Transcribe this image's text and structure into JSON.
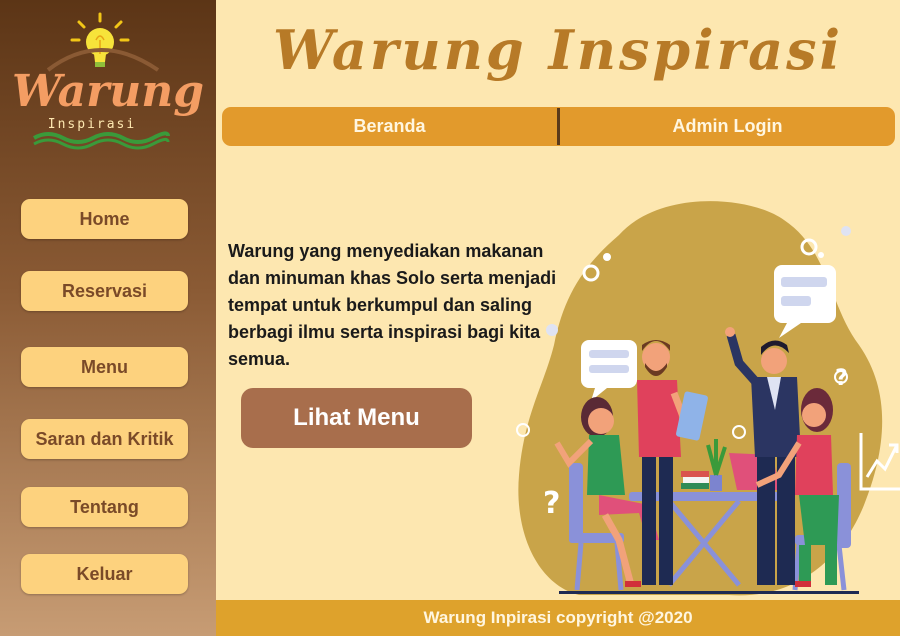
{
  "logo": {
    "word": "Warung",
    "sub": "Inspirasi"
  },
  "sidebar": {
    "items": [
      {
        "label": "Home"
      },
      {
        "label": "Reservasi"
      },
      {
        "label": "Menu"
      },
      {
        "label": "Saran dan Kritik"
      },
      {
        "label": "Tentang"
      },
      {
        "label": "Keluar"
      }
    ]
  },
  "header": {
    "title": "Warung Inspirasi"
  },
  "topnav": {
    "items": [
      {
        "label": "Beranda"
      },
      {
        "label": "Admin Login"
      }
    ]
  },
  "main": {
    "description": "Warung yang menyediakan makanan dan minuman khas Solo serta menjadi tempat untuk berkumpul dan saling berbagi ilmu serta inspirasi bagi kita semua.",
    "cta_label": "Lihat Menu"
  },
  "footer": {
    "text": "Warung Inpirasi copyright @2020"
  },
  "colors": {
    "sidebar_top": "#5c3516",
    "main_bg": "#fde7b0",
    "nav_button": "#fdd27e",
    "topnav": "#e29a2c",
    "cta": "#a86e4c",
    "title": "#b77a27",
    "footer": "#dea22c",
    "blob": "#c9a449"
  },
  "icons": [
    "lightbulb-icon",
    "chat-bubble-icon",
    "question-mark-icon",
    "growth-chart-icon"
  ]
}
